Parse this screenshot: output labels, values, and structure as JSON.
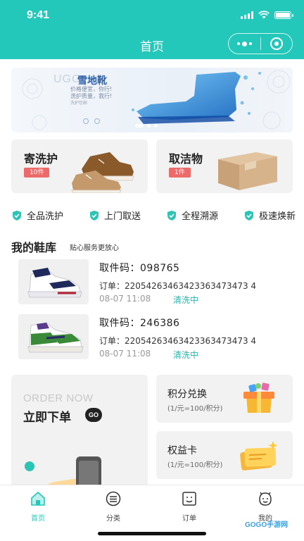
{
  "status_bar": {
    "time": "9:41"
  },
  "header": {
    "title": "首页"
  },
  "banner": {
    "brand": "UGG",
    "title": "雪地靴",
    "slogan_1": "价格便宜，你行!",
    "slogan_2": "洗护质量，我行!",
    "slogan_3": "洗护包邮"
  },
  "services": [
    {
      "title": "寄洗护",
      "badge": "10件"
    },
    {
      "title": "取洁物",
      "badge": "1件"
    }
  ],
  "features": [
    "全品洗护",
    "上门取送",
    "全程溯源",
    "极速焕新"
  ],
  "shoe_library": {
    "title": "我的鞋库",
    "subtitle": "贴心服务更放心",
    "orders": [
      {
        "pickup": "取件码：098765",
        "order_no": "订单：22054263463423363473473 4",
        "date": "08-07 11:08",
        "status": "清洗中"
      },
      {
        "pickup": "取件码：246386",
        "order_no": "订单：22054263463423363473473 4",
        "date": "08-07 11:08",
        "status": "清洗中"
      }
    ]
  },
  "order_now": {
    "en": "ORDER NOW",
    "cn": "立即下单",
    "go": "GO"
  },
  "side_cards": [
    {
      "title": "积分兑换",
      "sub": "(1/元=100/积分)"
    },
    {
      "title": "权益卡",
      "sub": "(1/元=100/积分)"
    }
  ],
  "tabs": [
    {
      "label": "首页",
      "icon": "home-icon",
      "active": true
    },
    {
      "label": "分类",
      "icon": "category-icon",
      "active": false
    },
    {
      "label": "订单",
      "icon": "order-icon",
      "active": false
    },
    {
      "label": "我的",
      "icon": "profile-icon",
      "active": false
    }
  ],
  "watermark": "GOGO手游网",
  "colors": {
    "accent": "#24c8bb",
    "badge": "#ec6a6a",
    "status": "#24b8b0"
  }
}
